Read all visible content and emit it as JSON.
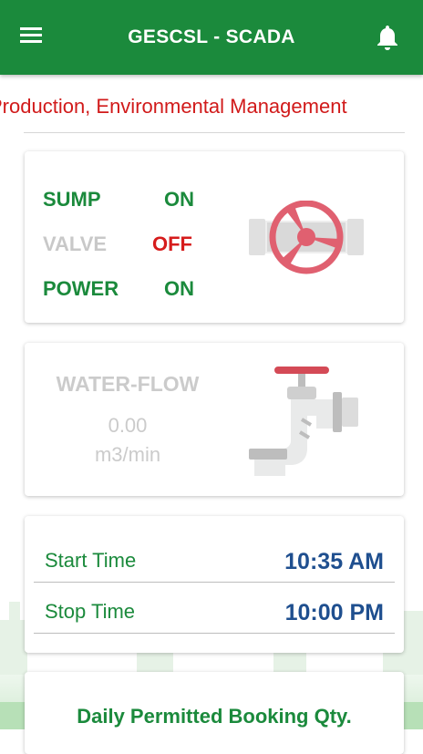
{
  "header": {
    "title": "GESCSL - SCADA",
    "menu_icon": "hamburger-menu-icon",
    "notification_icon": "bell-icon"
  },
  "ticker": {
    "text": "Production, Environmental Management"
  },
  "status_card": {
    "rows": [
      {
        "label": "SUMP",
        "value": "ON",
        "label_color": "#1b8a3c",
        "value_color": "#1b8a3c"
      },
      {
        "label": "VALVE",
        "value": "OFF",
        "label_color": "#c8c8c8",
        "value_color": "#d61c1c"
      },
      {
        "label": "POWER",
        "value": "ON",
        "label_color": "#1b8a3c",
        "value_color": "#1b8a3c"
      }
    ],
    "icon": "valve-wheel-icon"
  },
  "water_flow": {
    "title": "WATER-FLOW",
    "value": "0.00",
    "unit": "m3/min",
    "icon": "water-tap-icon"
  },
  "schedule": {
    "start_label": "Start Time",
    "start_value": "10:35 AM",
    "stop_label": "Stop Time",
    "stop_value": "10:00 PM"
  },
  "booking": {
    "title": "Daily Permitted Booking Qty."
  },
  "colors": {
    "primary_green": "#1b8a3c",
    "alert_red": "#d61c1c",
    "time_blue": "#1f4f8f",
    "disabled_grey": "#c8c8c8"
  }
}
